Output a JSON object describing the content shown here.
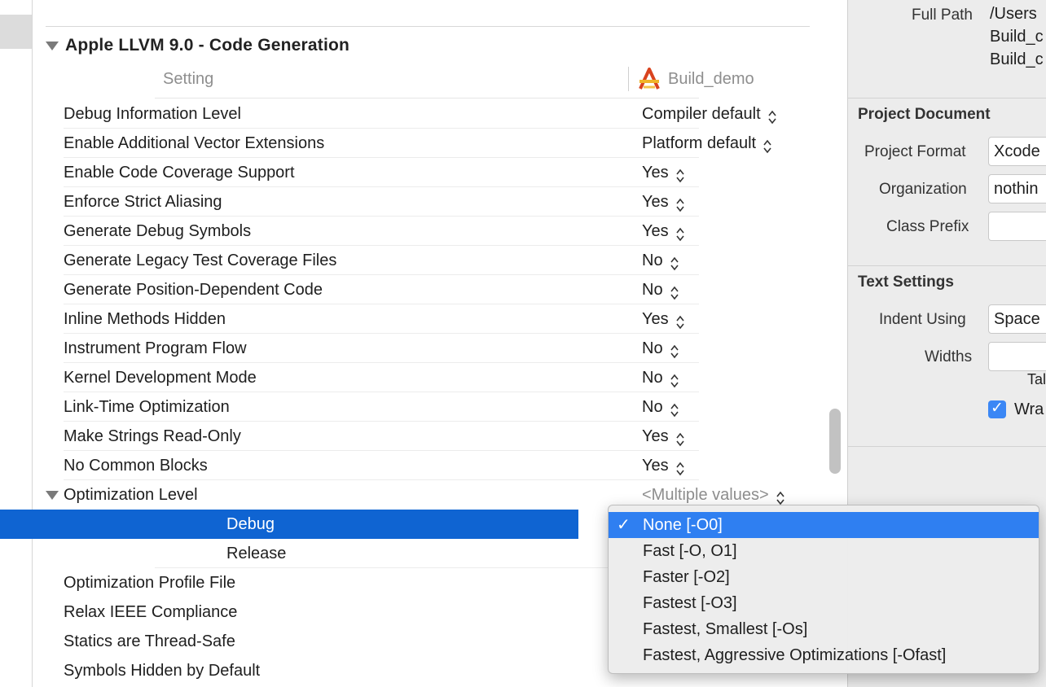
{
  "section": {
    "title": "Apple LLVM 9.0 - Code Generation"
  },
  "columns": {
    "setting": "Setting",
    "target": "Build_demo"
  },
  "settings": [
    {
      "label": "Debug Information Level",
      "value": "Compiler default"
    },
    {
      "label": "Enable Additional Vector Extensions",
      "value": "Platform default"
    },
    {
      "label": "Enable Code Coverage Support",
      "value": "Yes"
    },
    {
      "label": "Enforce Strict Aliasing",
      "value": "Yes"
    },
    {
      "label": "Generate Debug Symbols",
      "value": "Yes"
    },
    {
      "label": "Generate Legacy Test Coverage Files",
      "value": "No"
    },
    {
      "label": "Generate Position-Dependent Code",
      "value": "No"
    },
    {
      "label": "Inline Methods Hidden",
      "value": "Yes"
    },
    {
      "label": "Instrument Program Flow",
      "value": "No"
    },
    {
      "label": "Kernel Development Mode",
      "value": "No"
    },
    {
      "label": "Link-Time Optimization",
      "value": "No"
    },
    {
      "label": "Make Strings Read-Only",
      "value": "Yes"
    },
    {
      "label": "No Common Blocks",
      "value": "Yes"
    }
  ],
  "optimization": {
    "label": "Optimization Level",
    "value": "<Multiple values>",
    "debug_label": "Debug",
    "release_label": "Release"
  },
  "more_settings": [
    {
      "label": "Optimization Profile File"
    },
    {
      "label": "Relax IEEE Compliance"
    },
    {
      "label": "Statics are Thread-Safe"
    },
    {
      "label": "Symbols Hidden by Default"
    }
  ],
  "popup": {
    "items": [
      {
        "label": "None [-O0]",
        "checked": true
      },
      {
        "label": "Fast [-O, O1]"
      },
      {
        "label": "Faster [-O2]"
      },
      {
        "label": "Fastest [-O3]"
      },
      {
        "label": "Fastest, Smallest [-Os]"
      },
      {
        "label": "Fastest, Aggressive Optimizations [-Ofast]"
      }
    ],
    "check_glyph": "✓"
  },
  "inspector": {
    "full_path_label": "Full Path",
    "full_path_lines": [
      "/Users",
      "Build_c",
      "Build_c"
    ],
    "project_document": {
      "title": "Project Document",
      "format_label": "Project Format",
      "format_value": "Xcode",
      "organization_label": "Organization",
      "organization_value": "nothin",
      "class_prefix_label": "Class Prefix",
      "class_prefix_value": ""
    },
    "text_settings": {
      "title": "Text Settings",
      "indent_label": "Indent Using",
      "indent_value": "Space",
      "widths_label": "Widths",
      "tab_label": "Tal",
      "wrap_label": "Wra"
    }
  },
  "colors": {
    "selection": "#0f64d2",
    "menu_highlight": "#2f7ff1",
    "checkbox": "#3b87f5"
  }
}
